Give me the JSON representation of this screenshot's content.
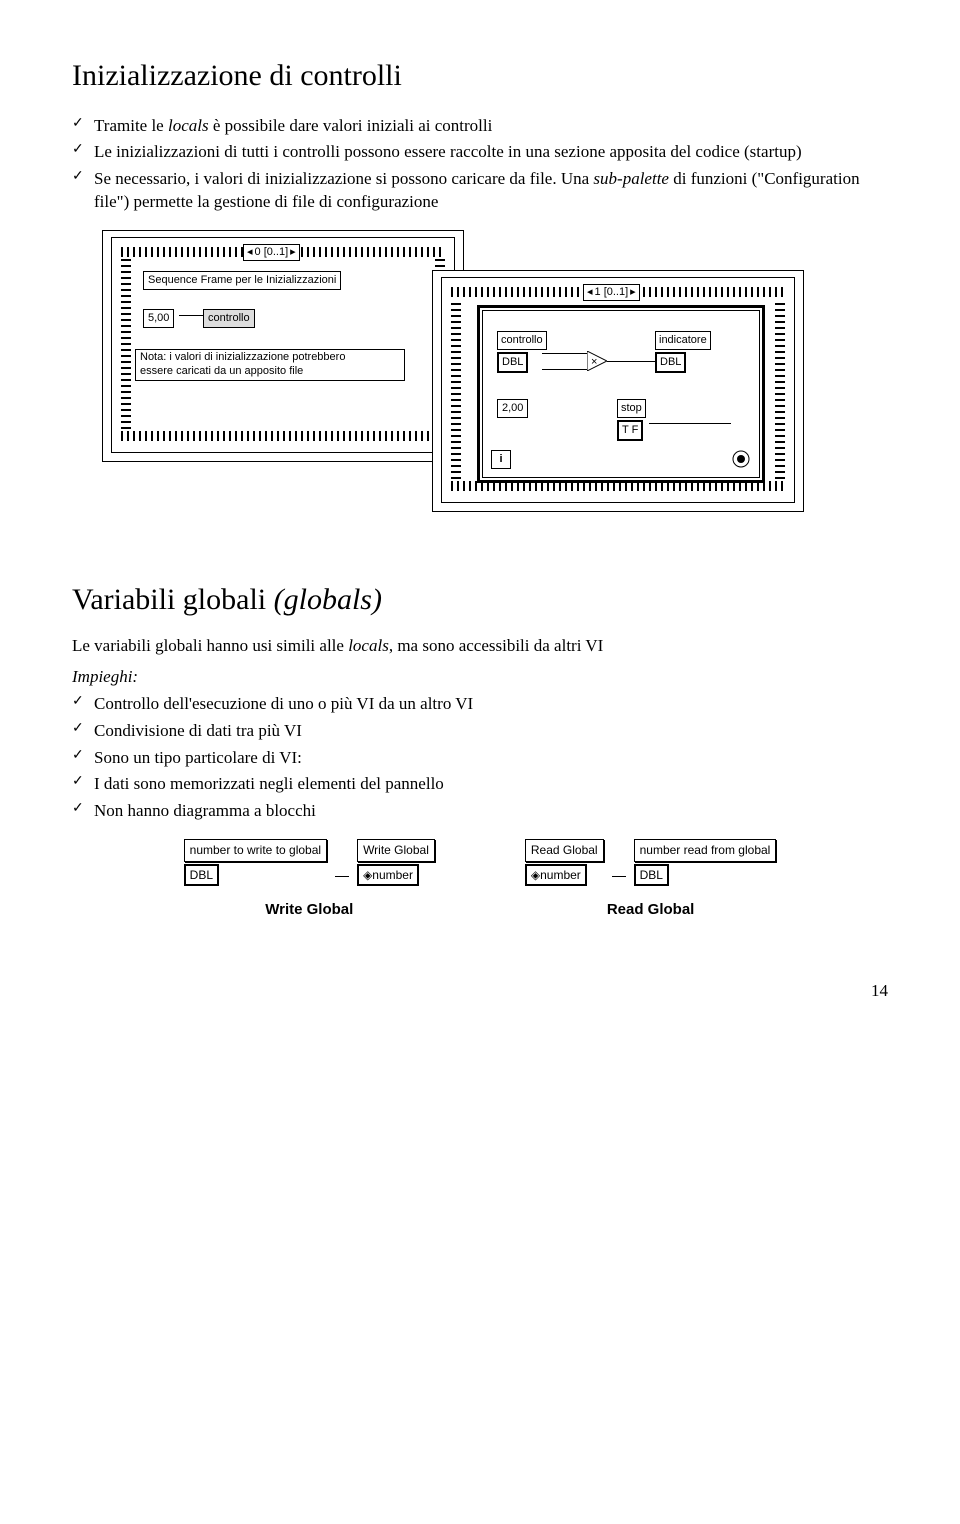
{
  "section1": {
    "title": "Inizializzazione di controlli",
    "bullets": [
      {
        "pre": "Tramite le ",
        "it": "locals",
        "post": " è possibile dare valori iniziali ai controlli"
      },
      {
        "pre": "Le inizializzazioni di tutti i controlli possono essere raccolte in una sezione apposita del codice (startup)",
        "it": "",
        "post": ""
      },
      {
        "pre": "Se necessario, i valori di inizializzazione si possono caricare da file. Una ",
        "it": "sub-palette",
        "post": " di funzioni (\"Configuration file\") permette la gestione di file di configurazione"
      }
    ]
  },
  "diagram1": {
    "left": {
      "nav": "0 [0..1]",
      "seq_label": "Sequence Frame per le Inizializzazioni",
      "val": "5,00",
      "ctrl": "controllo",
      "note": "Nota: i valori di inizializzazione potrebbero\nessere caricati da un apposito file"
    },
    "right": {
      "nav": "1 [0..1]",
      "ctrl": "controllo",
      "ctrl_type": "DBL",
      "ind": "indicatore",
      "ind_type": "DBL",
      "const": "2,00",
      "stop": "stop",
      "stop_type": "T F",
      "i": "i"
    }
  },
  "section2": {
    "title": "Variabili globali (globals)",
    "intro_pre": "Le variabili globali hanno usi simili alle ",
    "intro_it": "locals",
    "intro_post": ", ma sono accessibili da altri VI",
    "impieghi_label": "Impieghi:",
    "bullets": [
      "Controllo dell'esecuzione di uno o più VI da un altro VI",
      "Condivisione di dati tra più VI",
      "Sono un tipo particolare di VI:",
      "I dati sono memorizzati negli elementi del pannello",
      "Non hanno diagramma a blocchi"
    ]
  },
  "diagram2": {
    "write": {
      "label1": "number to write to global",
      "type1": "DBL",
      "box": "Write Global",
      "glyph": "◈number",
      "caption": "Write Global"
    },
    "read": {
      "box": "Read Global",
      "glyph": "◈number",
      "label1": "number read from global",
      "type1": "DBL",
      "caption": "Read Global"
    }
  },
  "page": "14"
}
